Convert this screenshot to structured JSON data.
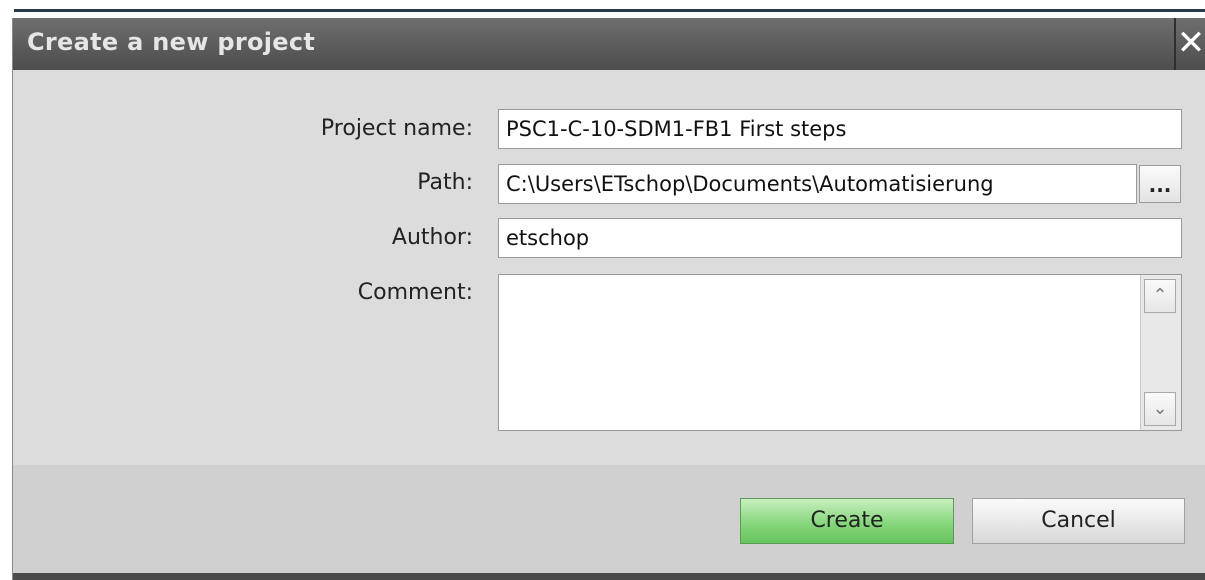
{
  "dialog": {
    "title": "Create a new project",
    "close_label": "✕",
    "fields": {
      "project_name": {
        "label": "Project name:",
        "value": "PSC1-C-10-SDM1-FB1 First steps"
      },
      "path": {
        "label": "Path:",
        "value": "C:\\Users\\ETschop\\Documents\\Automatisierung",
        "browse_label": "..."
      },
      "author": {
        "label": "Author:",
        "value": "etschop"
      },
      "comment": {
        "label": "Comment:",
        "value": ""
      }
    },
    "scroll": {
      "up": "⌃",
      "down": "⌄"
    },
    "buttons": {
      "create": "Create",
      "cancel": "Cancel"
    }
  },
  "colors": {
    "titlebar": "#5a5a5a",
    "create_button": "#86d77c",
    "dialog_background": "#dcdcdc"
  }
}
